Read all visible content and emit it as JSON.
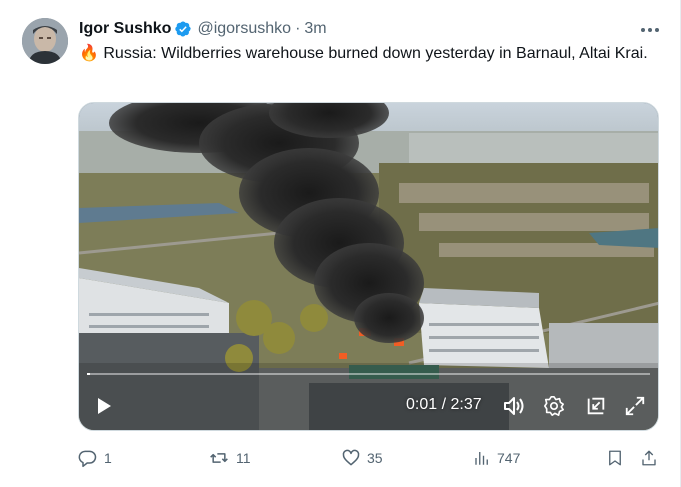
{
  "author": {
    "name": "Igor Sushko",
    "handle": "@igorsushko",
    "separator": "·",
    "time": "3m"
  },
  "tweet": {
    "emoji": "🔥",
    "text": "Russia: Wildberries warehouse burned down yesterday in Barnaul, Altai Krai."
  },
  "video": {
    "timecode": "0:01 / 2:37",
    "progress_fraction": 0.006
  },
  "actions": {
    "replies": "1",
    "reposts": "11",
    "likes": "35",
    "views": "747"
  },
  "colors": {
    "text_primary": "#0f1419",
    "text_secondary": "#536471",
    "verified_blue": "#1d9bf0"
  }
}
